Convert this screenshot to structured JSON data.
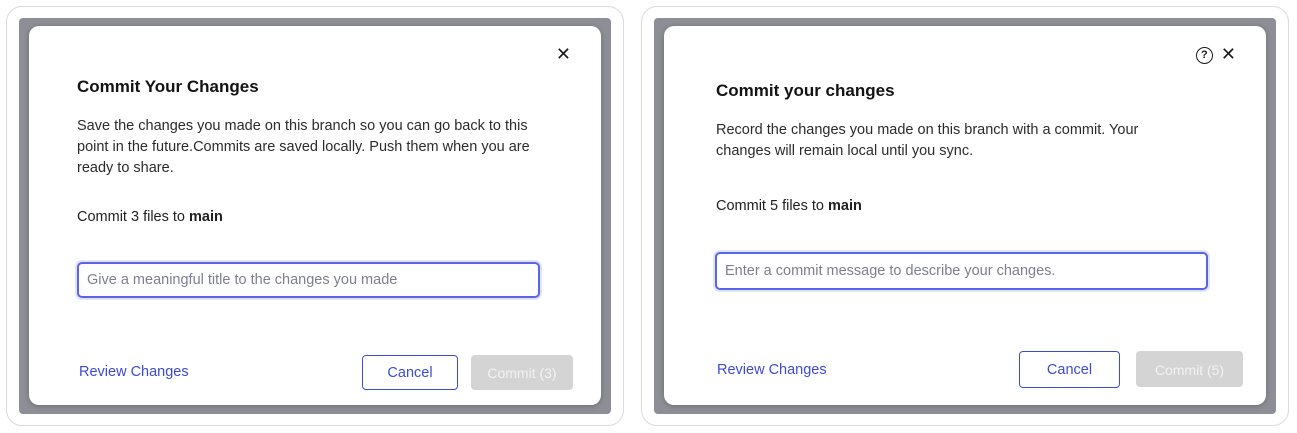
{
  "left_dialog": {
    "title": "Commit Your Changes",
    "description": "Save the changes you made on this branch so you can go back to this point in the future.Commits are saved locally. Push them when you are ready to share.",
    "commit_prefix": "Commit 3 files to ",
    "branch": "main",
    "input_placeholder": "Give a meaningful title to the changes you made",
    "input_value": "",
    "review_label": "Review Changes",
    "cancel_label": "Cancel",
    "commit_label": "Commit (3)",
    "close_icon": "close-icon"
  },
  "right_dialog": {
    "title": "Commit your changes",
    "description": "Record the changes you made on this branch with a commit. Your changes will remain local until you sync.",
    "commit_prefix": "Commit 5 files to ",
    "branch": "main",
    "input_placeholder": "Enter a commit message to describe your changes.",
    "input_value": "",
    "review_label": "Review Changes",
    "cancel_label": "Cancel",
    "commit_label": "Commit (5)",
    "help_icon": "help-icon",
    "help_glyph": "?",
    "close_icon": "close-icon"
  },
  "colors": {
    "accent": "#3b4bd6",
    "input_focus": "#5865e8",
    "disabled_button": "#d4d4d4",
    "backdrop": "#8e8f96"
  }
}
